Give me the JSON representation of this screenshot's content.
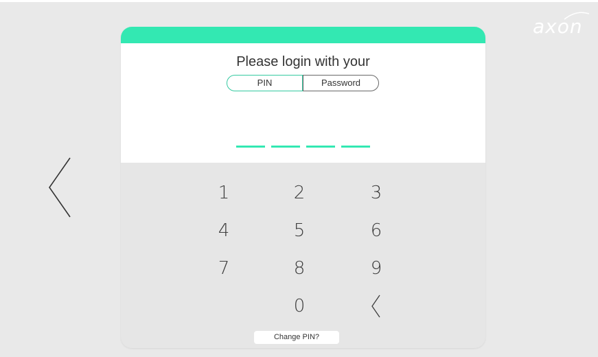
{
  "brand": {
    "name": "axon"
  },
  "login": {
    "prompt": "Please login with your",
    "toggle": {
      "pin_label": "PIN",
      "password_label": "Password",
      "selected": "PIN"
    },
    "pin_entered_digits": 0,
    "pin_length": 4
  },
  "keypad": {
    "keys": [
      "1",
      "2",
      "3",
      "4",
      "5",
      "6",
      "7",
      "8",
      "9",
      "0"
    ],
    "backspace_icon": "chevron-left-icon"
  },
  "footer": {
    "change_pin_label": "Change PIN?"
  },
  "navigation": {
    "back_icon": "chevron-left-icon"
  },
  "colors": {
    "accent": "#33e8b2",
    "background": "#e9e9e9",
    "keypad_background": "#e6e6e6",
    "card_top": "#ffffff"
  }
}
